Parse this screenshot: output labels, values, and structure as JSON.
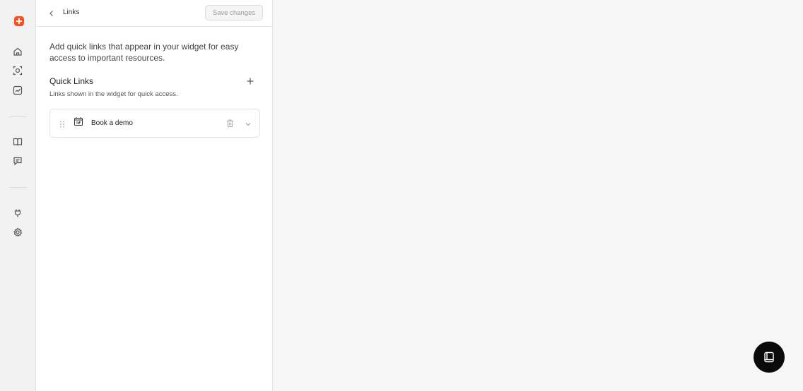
{
  "colors": {
    "brand": "#ff4f1f",
    "rail_bg": "#f2f2f2",
    "canvas_bg": "#f7f7f7",
    "fab_bg": "#0b0b0b"
  },
  "rail": {
    "icons": [
      "home-icon",
      "scan-face-icon",
      "analytics-icon",
      "book-icon",
      "chat-icon",
      "plug-icon",
      "gear-icon"
    ]
  },
  "header": {
    "title": "Links",
    "save_label": "Save changes"
  },
  "main": {
    "description": "Add quick links that appear in your widget for easy access to important resources.",
    "section_title": "Quick Links",
    "section_subtitle": "Links shown in the widget for quick access.",
    "links": [
      {
        "label": "Book a demo",
        "icon": "calendar-icon"
      }
    ]
  },
  "fab": {
    "icon": "widget-icon"
  }
}
